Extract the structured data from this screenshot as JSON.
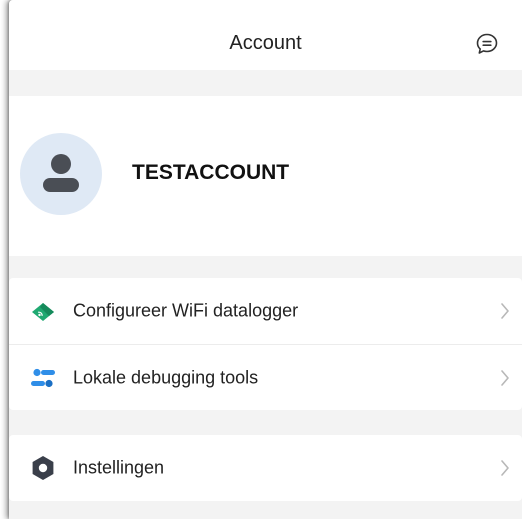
{
  "header": {
    "title": "Account",
    "message_icon": "chat-bubble-icon"
  },
  "profile": {
    "name": "TESTACCOUNT",
    "avatar_icon": "user-avatar-icon"
  },
  "menu": {
    "group1": [
      {
        "label": "Configureer WiFi datalogger",
        "icon": "wifi-datalogger-icon",
        "icon_color": "#1fa971"
      },
      {
        "label": "Lokale debugging tools",
        "icon": "debug-tools-icon",
        "icon_color": "#2f8ee8"
      }
    ],
    "group2": [
      {
        "label": "Instellingen",
        "icon": "gear-icon",
        "icon_color": "#3a3f4a"
      }
    ]
  },
  "colors": {
    "background": "#f3f3f3",
    "card": "#ffffff",
    "avatar_bg": "#dfe9f5",
    "avatar_figure": "#4a4e55",
    "chevron": "#b8b8b8"
  }
}
